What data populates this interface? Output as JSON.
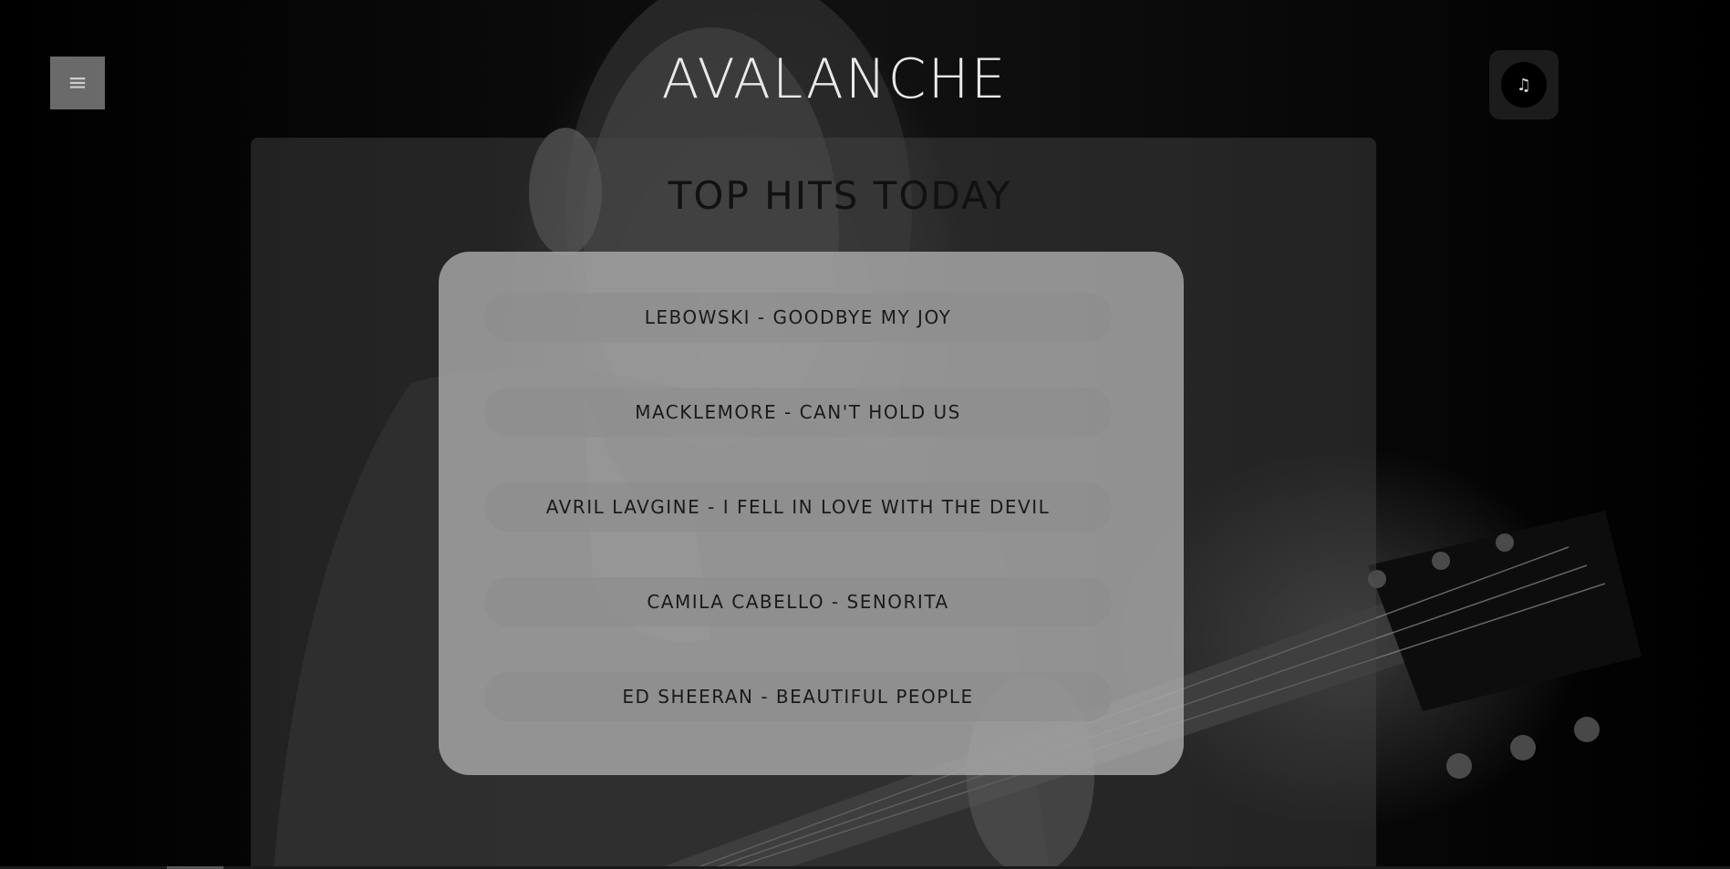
{
  "header": {
    "logo": "AVALANCHE",
    "menu_icon": "≡",
    "music_icon": "♫"
  },
  "main": {
    "title": "TOP HITS TODAY",
    "songs": [
      "LEBOWSKI - GOODBYE MY JOY",
      "MACKLEMORE - CAN'T HOLD US",
      "AVRIL LAVGINE - I FELL IN LOVE WITH THE DEVIL",
      "CAMILA CABELLO - SENORITA",
      "ED SHEERAN - BEAUTIFUL PEOPLE"
    ]
  }
}
